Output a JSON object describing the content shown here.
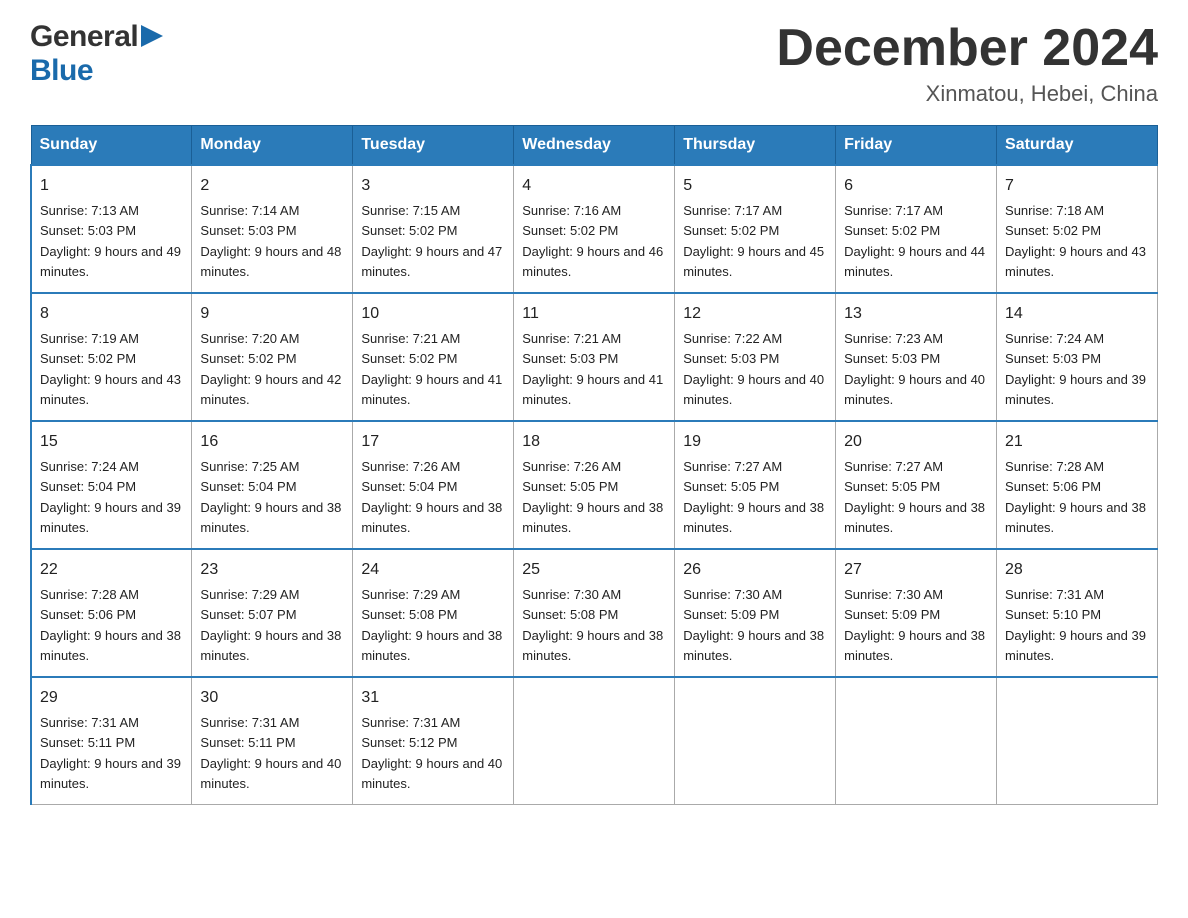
{
  "logo": {
    "general": "General",
    "triangle": "▶",
    "blue": "Blue"
  },
  "title": "December 2024",
  "subtitle": "Xinmatou, Hebei, China",
  "days_of_week": [
    "Sunday",
    "Monday",
    "Tuesday",
    "Wednesday",
    "Thursday",
    "Friday",
    "Saturday"
  ],
  "weeks": [
    [
      {
        "day": "1",
        "sunrise": "7:13 AM",
        "sunset": "5:03 PM",
        "daylight": "9 hours and 49 minutes."
      },
      {
        "day": "2",
        "sunrise": "7:14 AM",
        "sunset": "5:03 PM",
        "daylight": "9 hours and 48 minutes."
      },
      {
        "day": "3",
        "sunrise": "7:15 AM",
        "sunset": "5:02 PM",
        "daylight": "9 hours and 47 minutes."
      },
      {
        "day": "4",
        "sunrise": "7:16 AM",
        "sunset": "5:02 PM",
        "daylight": "9 hours and 46 minutes."
      },
      {
        "day": "5",
        "sunrise": "7:17 AM",
        "sunset": "5:02 PM",
        "daylight": "9 hours and 45 minutes."
      },
      {
        "day": "6",
        "sunrise": "7:17 AM",
        "sunset": "5:02 PM",
        "daylight": "9 hours and 44 minutes."
      },
      {
        "day": "7",
        "sunrise": "7:18 AM",
        "sunset": "5:02 PM",
        "daylight": "9 hours and 43 minutes."
      }
    ],
    [
      {
        "day": "8",
        "sunrise": "7:19 AM",
        "sunset": "5:02 PM",
        "daylight": "9 hours and 43 minutes."
      },
      {
        "day": "9",
        "sunrise": "7:20 AM",
        "sunset": "5:02 PM",
        "daylight": "9 hours and 42 minutes."
      },
      {
        "day": "10",
        "sunrise": "7:21 AM",
        "sunset": "5:02 PM",
        "daylight": "9 hours and 41 minutes."
      },
      {
        "day": "11",
        "sunrise": "7:21 AM",
        "sunset": "5:03 PM",
        "daylight": "9 hours and 41 minutes."
      },
      {
        "day": "12",
        "sunrise": "7:22 AM",
        "sunset": "5:03 PM",
        "daylight": "9 hours and 40 minutes."
      },
      {
        "day": "13",
        "sunrise": "7:23 AM",
        "sunset": "5:03 PM",
        "daylight": "9 hours and 40 minutes."
      },
      {
        "day": "14",
        "sunrise": "7:24 AM",
        "sunset": "5:03 PM",
        "daylight": "9 hours and 39 minutes."
      }
    ],
    [
      {
        "day": "15",
        "sunrise": "7:24 AM",
        "sunset": "5:04 PM",
        "daylight": "9 hours and 39 minutes."
      },
      {
        "day": "16",
        "sunrise": "7:25 AM",
        "sunset": "5:04 PM",
        "daylight": "9 hours and 38 minutes."
      },
      {
        "day": "17",
        "sunrise": "7:26 AM",
        "sunset": "5:04 PM",
        "daylight": "9 hours and 38 minutes."
      },
      {
        "day": "18",
        "sunrise": "7:26 AM",
        "sunset": "5:05 PM",
        "daylight": "9 hours and 38 minutes."
      },
      {
        "day": "19",
        "sunrise": "7:27 AM",
        "sunset": "5:05 PM",
        "daylight": "9 hours and 38 minutes."
      },
      {
        "day": "20",
        "sunrise": "7:27 AM",
        "sunset": "5:05 PM",
        "daylight": "9 hours and 38 minutes."
      },
      {
        "day": "21",
        "sunrise": "7:28 AM",
        "sunset": "5:06 PM",
        "daylight": "9 hours and 38 minutes."
      }
    ],
    [
      {
        "day": "22",
        "sunrise": "7:28 AM",
        "sunset": "5:06 PM",
        "daylight": "9 hours and 38 minutes."
      },
      {
        "day": "23",
        "sunrise": "7:29 AM",
        "sunset": "5:07 PM",
        "daylight": "9 hours and 38 minutes."
      },
      {
        "day": "24",
        "sunrise": "7:29 AM",
        "sunset": "5:08 PM",
        "daylight": "9 hours and 38 minutes."
      },
      {
        "day": "25",
        "sunrise": "7:30 AM",
        "sunset": "5:08 PM",
        "daylight": "9 hours and 38 minutes."
      },
      {
        "day": "26",
        "sunrise": "7:30 AM",
        "sunset": "5:09 PM",
        "daylight": "9 hours and 38 minutes."
      },
      {
        "day": "27",
        "sunrise": "7:30 AM",
        "sunset": "5:09 PM",
        "daylight": "9 hours and 38 minutes."
      },
      {
        "day": "28",
        "sunrise": "7:31 AM",
        "sunset": "5:10 PM",
        "daylight": "9 hours and 39 minutes."
      }
    ],
    [
      {
        "day": "29",
        "sunrise": "7:31 AM",
        "sunset": "5:11 PM",
        "daylight": "9 hours and 39 minutes."
      },
      {
        "day": "30",
        "sunrise": "7:31 AM",
        "sunset": "5:11 PM",
        "daylight": "9 hours and 40 minutes."
      },
      {
        "day": "31",
        "sunrise": "7:31 AM",
        "sunset": "5:12 PM",
        "daylight": "9 hours and 40 minutes."
      },
      null,
      null,
      null,
      null
    ]
  ]
}
